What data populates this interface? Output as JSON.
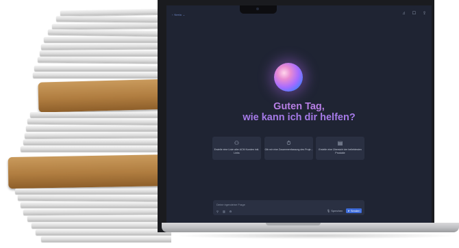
{
  "header": {
    "model_label": "Neela",
    "model_chevron": "⌄"
  },
  "top_icons": [
    "bell-icon",
    "chat-icon",
    "share-icon"
  ],
  "greeting": {
    "line1": "Guten Tag,",
    "line2": "wie kann ich dir helfen?"
  },
  "suggestions": [
    {
      "icon": "users-icon",
      "text": "Erstelle eine Liste aller ACM Kunden inkl. Links"
    },
    {
      "icon": "stopwatch-icon",
      "text": "Gib mir eine Zusammenfassung des Proje..."
    },
    {
      "icon": "document-icon",
      "text": "Erstelle eine Übersicht der beliebtesten Produkte"
    }
  ],
  "input": {
    "placeholder": "Deine irgendeine Frage",
    "voice_label": "Sprechen",
    "send_label": "Senden"
  },
  "colors": {
    "screen_bg": "#1f2433",
    "card_bg": "#2a3042",
    "accent": "#3d6bd9",
    "greeting": "#b87fe6"
  }
}
